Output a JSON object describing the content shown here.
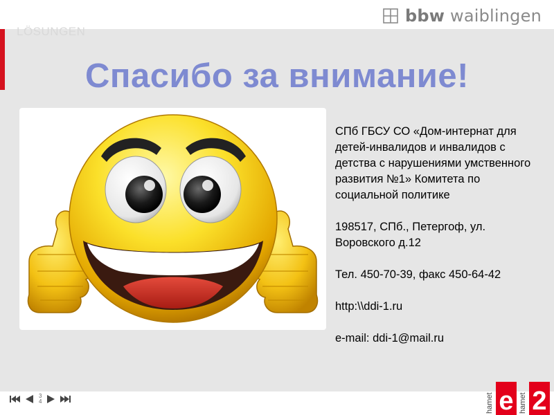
{
  "header": {
    "logo_text_bold": "bbw",
    "logo_text": "waiblingen",
    "watermark": "LÖSUNGEN"
  },
  "slide": {
    "title": "Спасибо за внимание!",
    "organization": "СПб ГБСУ СО «Дом-интернат для детей-инвалидов и инвалидов с детства с нарушениями умственного развития №1» Комитета по социальной политике",
    "address": "198517, СПб., Петергоф, ул. Воровского д.12",
    "phone": "Тел. 450-70-39, факс 450-64-42",
    "website": "http:\\\\ddi-1.ru",
    "email": "e-mail: ddi-1@mail.ru"
  },
  "footer": {
    "page_current": "3",
    "page_total": "4",
    "brand_left": "hamet",
    "brand_right": "hamet",
    "brand_mark": "e2"
  },
  "colors": {
    "title": "#7e8ad1",
    "accent_red": "#d5121f",
    "background": "#e6e6e6"
  },
  "icons": [
    "logo-mark-icon",
    "first-slide-icon",
    "prev-slide-icon",
    "next-slide-icon",
    "last-slide-icon",
    "smiley-thumbs-up-icon"
  ]
}
